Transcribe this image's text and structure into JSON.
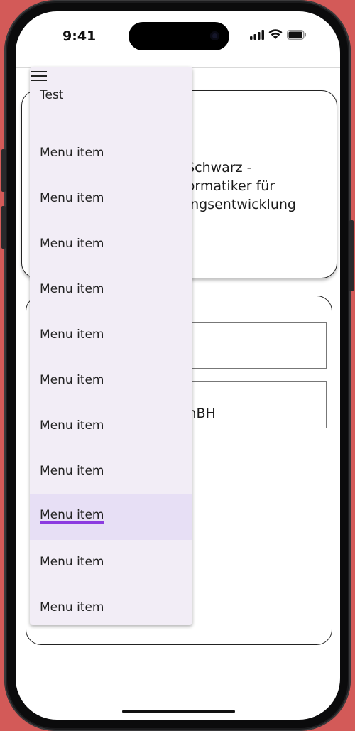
{
  "status_bar": {
    "time": "9:41",
    "icons": [
      "cellular-signal-icon",
      "wifi-icon",
      "battery-icon"
    ]
  },
  "app_bar": {
    "menu_icon": "hamburger-menu-icon"
  },
  "card1": {
    "text": "n Schwarz -\nnformatiker für\ndungsentwicklung"
  },
  "card2": {
    "field2_value": "mBH"
  },
  "menu": {
    "header": "Test",
    "items": [
      {
        "label": "Menu item"
      },
      {
        "label": "Menu item"
      },
      {
        "label": "Menu item"
      },
      {
        "label": "Menu item"
      },
      {
        "label": "Menu item"
      },
      {
        "label": "Menu item"
      },
      {
        "label": "Menu item"
      },
      {
        "label": "Menu item"
      },
      {
        "label": "Menu item"
      },
      {
        "label": "Menu item"
      },
      {
        "label": "Menu item"
      }
    ],
    "selected_index": 8
  },
  "colors": {
    "background": "#d35a58",
    "menu_surface": "#f2edf6",
    "menu_selected": "#e7dff5",
    "accent_underline": "#8c3be0"
  }
}
